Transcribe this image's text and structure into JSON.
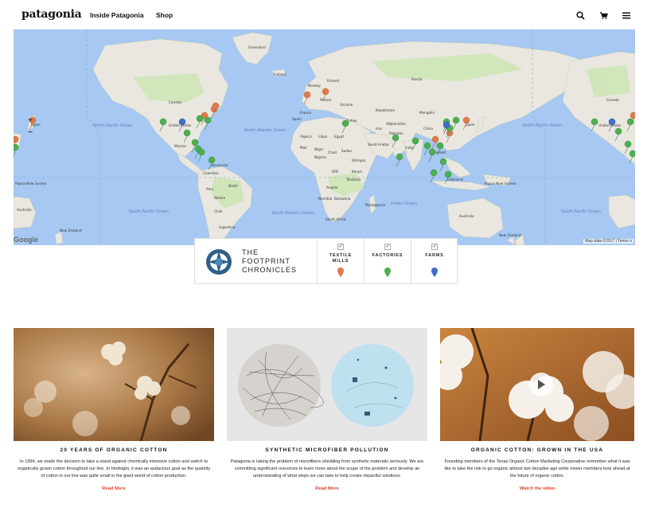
{
  "header": {
    "logo": "patagonia",
    "nav": {
      "inside": "Inside Patagonia",
      "shop": "Shop"
    },
    "icons": [
      "search-icon",
      "cart-icon",
      "menu-icon"
    ]
  },
  "map": {
    "zoom_in": "+",
    "zoom_out": "−",
    "google": "Google",
    "credit": "Map data ©2017 | Terms o",
    "labels": {
      "greenland": "Greenland",
      "iceland": "Iceland",
      "norway": "Norway",
      "finland": "Finland",
      "russia": "Russia",
      "poland": "Poland",
      "ukraine": "Ukraine",
      "kazakhstan": "Kazakhstan",
      "mongolia": "Mongolia",
      "china": "China",
      "japan_w": "Japan",
      "japan_e": "Japan",
      "canada": "Canada",
      "canada_r": "Canada",
      "us": "United States",
      "us_r": "United States",
      "mexico": "Mexico",
      "venezuela": "Venezuela",
      "colombia": "Colombia",
      "peru": "Peru",
      "brazil": "Brazil",
      "bolivia": "Bolivia",
      "chile": "Chile",
      "argentina": "Argentina",
      "france": "France",
      "spain": "Spain",
      "algeria": "Algeria",
      "libya": "Libya",
      "egypt": "Egypt",
      "mali": "Mali",
      "niger": "Niger",
      "chad": "Chad",
      "sudan": "Sudan",
      "nigeria": "Nigeria",
      "ethiopia": "Ethiopia",
      "kenya": "Kenya",
      "drc": "DRC",
      "tanzania": "Tanzania",
      "angola": "Angola",
      "namibia": "Namibia",
      "botswana": "Botswana",
      "madagascar": "Madagascar",
      "south_africa": "South Africa",
      "saudi": "Saudi Arabia",
      "turkey": "Turkey",
      "iran": "Iran",
      "afghanistan": "Afghanistan",
      "pakistan": "Pakistan",
      "india": "India",
      "thailand": "Thailand",
      "indonesia": "Indonesia",
      "png": "Papua New Guinea",
      "png_r": "Papua New Guinea",
      "australia": "Australia",
      "australia_l": "Australia",
      "new_zealand": "New Zealand",
      "new_zealand_l": "New Zealand",
      "north_pacific": "North Pacific Ocean",
      "north_pacific_r": "North Pacific Ocean",
      "north_atlantic": "North Atlantic Ocean",
      "south_pacific": "South Pacific Ocean",
      "south_pacific_r": "South Pacific Ocean",
      "south_atlantic": "South Atlantic Ocean",
      "indian": "Indian Ocean"
    }
  },
  "legend": {
    "title_lines": [
      "THE",
      "FOOTPRINT",
      "CHRONICLES"
    ],
    "filters": [
      {
        "label_lines": [
          "TEXTILE",
          "MILLS"
        ],
        "checked": "✓",
        "color": "#e07a4a"
      },
      {
        "label_lines": [
          "FACTORIES"
        ],
        "checked": "✓",
        "color": "#4caf50"
      },
      {
        "label_lines": [
          "FARMS"
        ],
        "checked": "✓",
        "color": "#3f6fc9"
      }
    ]
  },
  "cards": [
    {
      "title": "20 YEARS OF ORGANIC COTTON",
      "text": "In 1994, we made the decision to take a stand against chemically intensive cotton and switch to organically grown cotton throughout our line. In hindsight, it was an audacious goal as the quantity of cotton in our line was quite small in the giant world of cotton production.",
      "link": "Read More"
    },
    {
      "title": "SYNTHETIC MICROFIBER POLLUTION",
      "text": "Patagonia is taking the problem of microfibers shedding from synthetic materials seriously. We are committing significant resources to learn more about the scope of the problem and develop an understanding of what steps we can take to help create impactful solutions.",
      "link": "Read More"
    },
    {
      "title": "ORGANIC COTTON: GROWN IN THE USA",
      "text": "Founding members of the Texas Organic Cotton Marketing Cooperative remember what it was like to take the risk to go organic almost two decades ago while newer members look ahead at the future of organic cotton.",
      "link": "Watch the video"
    }
  ],
  "colors": {
    "ocean": "#a6c8f2",
    "land": "#e9e7df",
    "forest": "#cfe5b8",
    "link": "#d4462a",
    "mill": "#e07a4a",
    "factory": "#4caf50",
    "farm": "#3f6fc9"
  }
}
